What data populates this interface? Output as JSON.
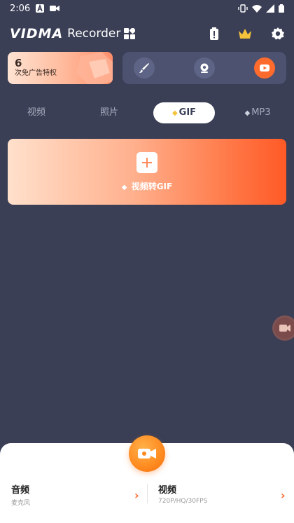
{
  "status": {
    "time": "2:06"
  },
  "header": {
    "logo": "VIDMA",
    "logo_sub": "Recorder"
  },
  "promo": {
    "count": "6",
    "label": "次免广告特权"
  },
  "tabs": [
    {
      "label": "视频",
      "gem": ""
    },
    {
      "label": "照片",
      "gem": ""
    },
    {
      "label": "GIF",
      "gem": "◆"
    },
    {
      "label": "MP3",
      "gem": "◆"
    }
  ],
  "gif_card": {
    "caption": "视频转GIF",
    "gem": "◆"
  },
  "bottom": {
    "audio": {
      "title": "音频",
      "sub": "麦克风"
    },
    "video": {
      "title": "视频",
      "sub": "720P/HQ/30FPS"
    },
    "chevron": "›"
  },
  "colors": {
    "accent": "#ff6a2d",
    "background": "#3a3f56",
    "gold": "#f5c33b"
  },
  "icons": [
    "battery-alert-icon",
    "crown-icon",
    "gear-icon",
    "brush-icon",
    "webcam-icon",
    "record-icon",
    "plus-icon",
    "video-camera-icon"
  ]
}
